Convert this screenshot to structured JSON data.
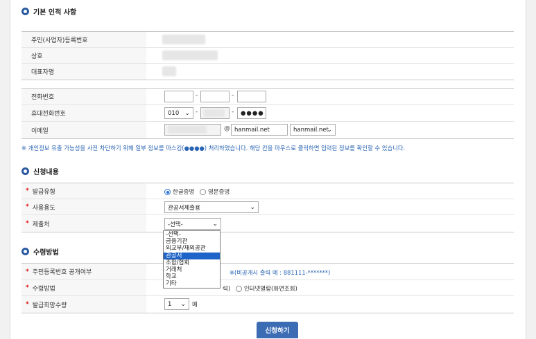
{
  "sections": {
    "basic_title": "기본 인적 사항",
    "apply_title": "신청내용",
    "receive_title": "수령방법"
  },
  "basic": {
    "resident_id_label": "주민(사업자)등록번호",
    "company_label": "상호",
    "ceo_label": "대표자명"
  },
  "contact": {
    "phone_label": "전화번호",
    "mobile_label": "휴대전화번호",
    "mobile_prefix": "010",
    "mobile_last": "●●●●",
    "email_label": "이메일",
    "email_at": "@",
    "email_domain": "hanmail.net",
    "email_domain_select": "hanmail.net",
    "phone_dash": "-"
  },
  "privacy_note": "※ 개인정보 유출 가능성을 사전 차단하기 위해 일부 정보를 마스킹(●●●●) 처리하였습니다. 해당 칸을 마우스로 클릭하면 입력된 정보를 확인할 수 있습니다.",
  "apply": {
    "star": "*",
    "issue_type_label": "발급유형",
    "issue_korean": "한글증명",
    "issue_english": "영문증명",
    "usage_label": "사용용도",
    "usage_value": "관공서제출용",
    "submit_to_label": "제출처",
    "submit_to_value": "-선택-",
    "submit_options": [
      "-선택-",
      "금융기관",
      "외교부/재외공관",
      "관공서",
      "조합/협회",
      "거래처",
      "학교",
      "기타"
    ]
  },
  "receive": {
    "disclose_label": "주민등록번호 공개여부",
    "disclose_note": "※(비공개시 출력 예 : 881111-*******)",
    "method_label": "수령방법",
    "method_partial": "력)",
    "method_online": "인터넷열람(화면조회)",
    "quantity_label": "발급희망수량",
    "quantity_value": "1",
    "quantity_unit": "매"
  },
  "submit_button": "신청하기"
}
